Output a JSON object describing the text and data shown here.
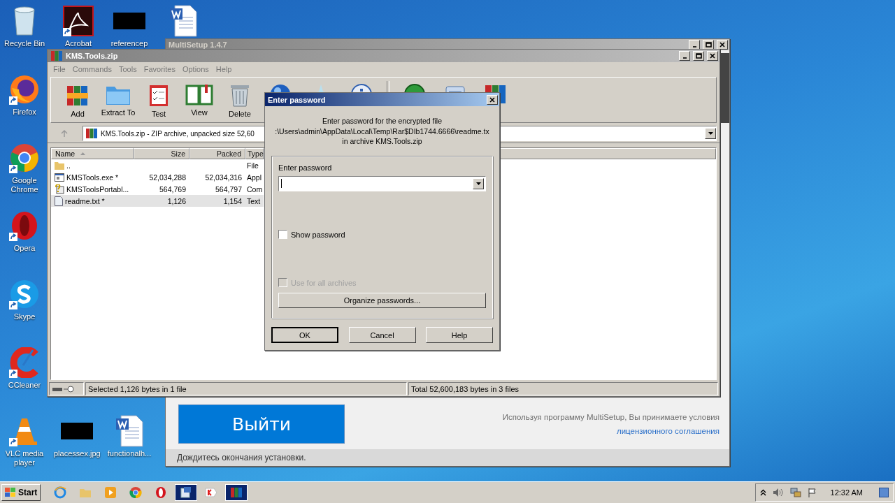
{
  "desktop": {
    "icons": [
      {
        "kind": "recycle",
        "label": "Recycle Bin",
        "shortcut": false
      },
      {
        "kind": "acrobat",
        "label": "Acrobat",
        "shortcut": true
      },
      {
        "kind": "thumbnail",
        "label": "referencep",
        "shortcut": false
      },
      {
        "kind": "word",
        "shortcut": false
      },
      {
        "kind": "firefox",
        "label": "Firefox",
        "shortcut": true
      },
      {
        "kind": "chrome",
        "label": "Google Chrome",
        "shortcut": true
      },
      {
        "kind": "opera",
        "label": "Opera",
        "shortcut": true
      },
      {
        "kind": "skype",
        "label": "Skype",
        "shortcut": true
      },
      {
        "kind": "ccleaner",
        "label": "CCleaner",
        "shortcut": true
      },
      {
        "kind": "vlc",
        "label": "VLC media player",
        "shortcut": true
      },
      {
        "kind": "thumbnail",
        "label": "placessex.jpg",
        "shortcut": false
      },
      {
        "kind": "word",
        "label": "functionalh...",
        "shortcut": false
      }
    ]
  },
  "background_window": {
    "title": "MultiSetup 1.4.7",
    "exit_button": "Выйти",
    "notice": "Используя программу MultiSetup, Вы принимаете условия",
    "license_link": "лицензионного соглашения",
    "status": "Дождитесь окончания установки."
  },
  "archive_window": {
    "title": "KMS.Tools.zip",
    "menu": [
      "File",
      "Commands",
      "Tools",
      "Favorites",
      "Options",
      "Help"
    ],
    "toolbar": [
      {
        "kind": "add",
        "label": "Add"
      },
      {
        "kind": "extract",
        "label": "Extract To"
      },
      {
        "kind": "test",
        "label": "Test"
      },
      {
        "kind": "view",
        "label": "View"
      },
      {
        "kind": "delete",
        "label": "Delete"
      },
      {
        "kind": "find"
      },
      {
        "kind": "wizard"
      },
      {
        "kind": "info"
      },
      {
        "kind": "virus"
      },
      {
        "kind": "comment"
      },
      {
        "kind": "sfx"
      }
    ],
    "address": "KMS.Tools.zip - ZIP archive, unpacked size 52,60",
    "columns": [
      {
        "label": "Name",
        "sorted": true
      },
      {
        "label": "Size",
        "sorted": false
      },
      {
        "label": "Packed",
        "sorted": false
      },
      {
        "label": "Type",
        "sorted": false
      }
    ],
    "rows": [
      {
        "kind": "folder",
        "name": "..",
        "size": "",
        "packed": "",
        "type": "File",
        "selected": false
      },
      {
        "kind": "exe",
        "name": "KMSTools.exe *",
        "size": "52,034,288",
        "packed": "52,034,316",
        "type": "Appl",
        "selected": false
      },
      {
        "kind": "setup",
        "name": "KMSToolsPortabl...",
        "size": "564,769",
        "packed": "564,797",
        "type": "Com",
        "selected": false
      },
      {
        "kind": "text",
        "name": "readme.txt *",
        "size": "1,126",
        "packed": "1,154",
        "type": "Text",
        "selected": true
      }
    ],
    "status_left": "Selected 1,126 bytes in 1 file",
    "status_right": "Total 52,600,183 bytes in 3 files"
  },
  "dialog": {
    "title": "Enter password",
    "message": [
      "Enter password for the encrypted file",
      ":\\Users\\admin\\AppData\\Local\\Temp\\Rar$DIb1744.6666\\readme.tx",
      "in archive KMS.Tools.zip"
    ],
    "field_label": "Enter password",
    "options": [
      {
        "label": "Show password",
        "checked": false,
        "disabled": false
      },
      {
        "label": "Use for all archives",
        "checked": false,
        "disabled": true
      }
    ],
    "organize_button": "Organize passwords...",
    "buttons": [
      {
        "label": "OK",
        "default": true
      },
      {
        "label": "Cancel",
        "default": false
      },
      {
        "label": "Help",
        "default": false
      }
    ]
  },
  "taskbar": {
    "start": "Start",
    "items": [
      {
        "kind": "ie",
        "selected": false
      },
      {
        "kind": "explorer",
        "selected": false
      },
      {
        "kind": "media",
        "selected": false
      },
      {
        "kind": "chrome",
        "selected": false
      },
      {
        "kind": "opera",
        "selected": false
      },
      {
        "kind": "setup",
        "selected": true
      },
      {
        "kind": "yandex",
        "selected": false
      },
      {
        "kind": "winrar",
        "selected": true
      }
    ],
    "tray": [
      {
        "kind": "chevron"
      },
      {
        "kind": "speaker"
      },
      {
        "kind": "network"
      },
      {
        "kind": "flag"
      }
    ],
    "clock": "12:32 AM"
  }
}
